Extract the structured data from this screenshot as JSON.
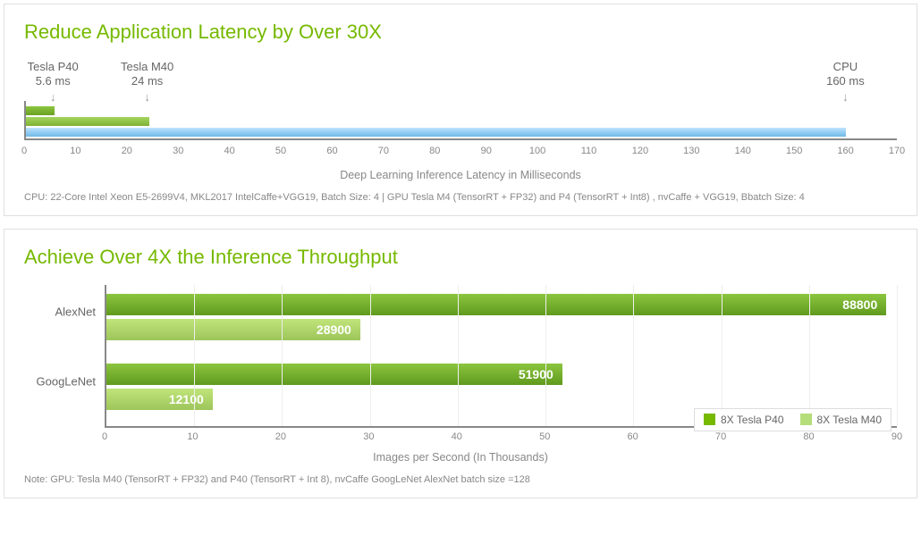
{
  "chart_data": [
    {
      "type": "bar",
      "orientation": "horizontal",
      "title": "Reduce Application Latency by Over 30X",
      "xlabel": "Deep Learning Inference Latency in Milliseconds",
      "xlim": [
        0,
        170
      ],
      "xticks": [
        0,
        10,
        20,
        30,
        40,
        50,
        60,
        70,
        80,
        90,
        100,
        110,
        120,
        130,
        140,
        150,
        160,
        170
      ],
      "series": [
        {
          "name": "Tesla P40",
          "value": 5.6,
          "callout": "Tesla P40\n5.6 ms"
        },
        {
          "name": "Tesla M40",
          "value": 24,
          "callout": "Tesla M40\n24 ms"
        },
        {
          "name": "CPU",
          "value": 160,
          "callout": "CPU\n160 ms"
        }
      ],
      "footnote": "CPU: 22-Core Intel Xeon E5-2699V4, MKL2017 IntelCaffe+VGG19, Batch Size: 4  |  GPU Tesla M4 (TensorRT + FP32) and P4 (TensorRT + Int8) , nvCaffe + VGG19, Bbatch Size: 4"
    },
    {
      "type": "bar",
      "orientation": "horizontal",
      "title": "Achieve Over 4X the Inference Throughput",
      "xlabel": "Images per Second (In Thousands)",
      "xlim": [
        0,
        90
      ],
      "xticks": [
        0,
        10,
        20,
        30,
        40,
        50,
        60,
        70,
        80,
        90
      ],
      "categories": [
        "AlexNet",
        "GoogLeNet"
      ],
      "series": [
        {
          "name": "8X Tesla P40",
          "values": [
            88800,
            51900
          ]
        },
        {
          "name": "8X Tesla M40",
          "values": [
            28900,
            12100
          ]
        }
      ],
      "footnote": "Note: GPU: Tesla  M40 (TensorRT + FP32) and P40 (TensorRT + Int 8), nvCaffe GoogLeNet AlexNet batch size =128"
    }
  ],
  "callouts": {
    "p40_name": "Tesla P40",
    "p40_val": "5.6 ms",
    "m40_name": "Tesla M40",
    "m40_val": "24 ms",
    "cpu_name": "CPU",
    "cpu_val": "160 ms"
  },
  "legend": {
    "p40": "8X Tesla P40",
    "m40": "8X Tesla M40"
  },
  "values": {
    "alexnet_p40": "88800",
    "alexnet_m40": "28900",
    "googlenet_p40": "51900",
    "googlenet_m40": "12100"
  }
}
